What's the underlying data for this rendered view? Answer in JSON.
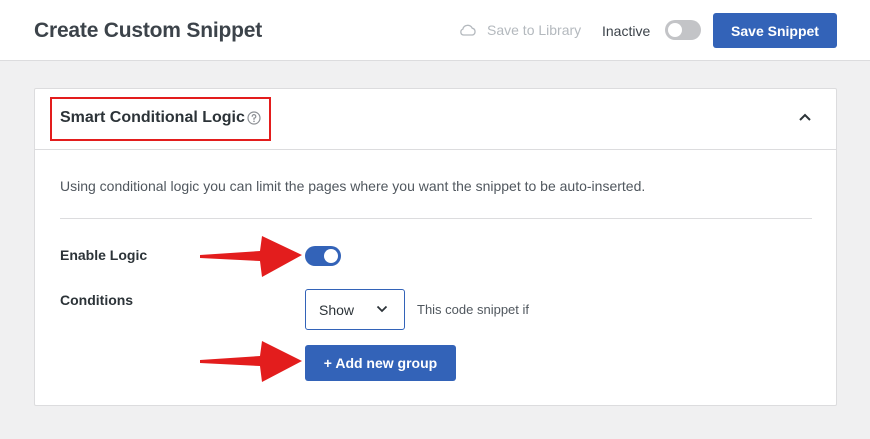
{
  "header": {
    "title": "Create Custom Snippet",
    "save_to_library": "Save to Library",
    "status_label": "Inactive",
    "active": false,
    "save_button": "Save Snippet"
  },
  "panel": {
    "title": "Smart Conditional Logic",
    "description": "Using conditional logic you can limit the pages where you want the snippet to be auto-inserted.",
    "enable_logic_label": "Enable Logic",
    "enable_logic_on": true,
    "conditions_label": "Conditions",
    "conditions_select_value": "Show",
    "conditions_suffix": "This code snippet if",
    "add_group_button": "+ Add new group"
  },
  "colors": {
    "primary": "#3363b8",
    "annotation_red": "#e31d1d",
    "background": "#f0f0f1"
  },
  "icons": [
    "cloud-icon",
    "help-icon",
    "chevron-up-icon",
    "chevron-down-icon",
    "arrow-annotation"
  ]
}
